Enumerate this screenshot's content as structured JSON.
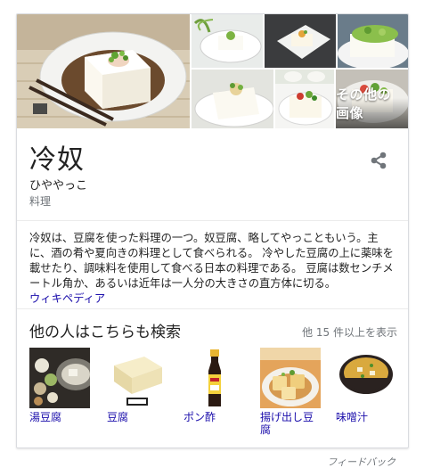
{
  "knowledge_panel": {
    "more_images_label": "その他の画像",
    "title": "冷奴",
    "reading": "ひややっこ",
    "category": "料理",
    "share_icon": "share-icon",
    "description": "冷奴は、豆腐を使った料理の一つ。奴豆腐、略してやっこともいう。主に、酒の肴や夏向きの料理として食べられる。 冷やした豆腐の上に薬味を載せたり、調味料を使用して食べる日本の料理である。 豆腐は数センチメートル角か、あるいは近年は一人分の大きさの直方体に切る。",
    "source_link": "ウィキペディア"
  },
  "people_also_search": {
    "heading": "他の人はこちらも検索",
    "more_label": "他 15 件以上を表示",
    "items": [
      {
        "label": "湯豆腐"
      },
      {
        "label": "豆腐"
      },
      {
        "label": "ポン酢"
      },
      {
        "label": "揚げ出し豆腐"
      },
      {
        "label": "味噌汁"
      }
    ]
  },
  "footer": {
    "feedback_label": "フィードバック"
  },
  "colors": {
    "link": "#1a0dab",
    "secondary_text": "#70757a",
    "border": "#dadce0"
  }
}
